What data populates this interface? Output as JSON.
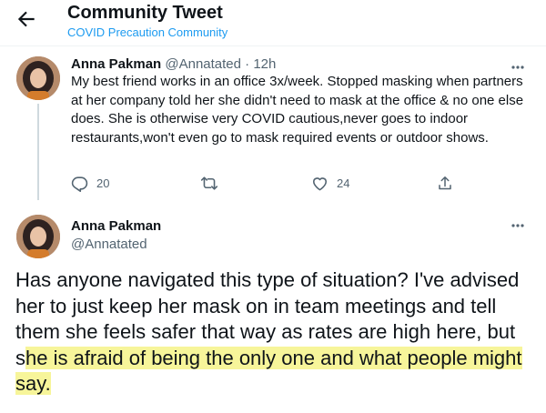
{
  "header": {
    "title": "Community Tweet",
    "subtitle": "COVID Precaution Community"
  },
  "tweet1": {
    "name": "Anna Pakman",
    "handle": "@Annatated",
    "separator": " · ",
    "time": "12h",
    "text": "My best friend works in an office 3x/week. Stopped masking when partners at her company told her she didn't need to mask at the office & no one else does. She is otherwise very COVID cautious,never goes to indoor restaurants,won't even go to mask required events or outdoor shows.",
    "replies": "20",
    "retweets": "",
    "likes": "24"
  },
  "tweet2": {
    "name": "Anna Pakman",
    "handle": "@Annatated",
    "text_plain": "Has anyone navigated this type of situation? I've advised her to just keep her mask on in team meetings and tell them she feels safer that way as rates are high here, but s",
    "text_highlight": "he is afraid of being the only one and what people might say."
  },
  "colors": {
    "accent": "#1d9bf0",
    "muted": "#536471",
    "highlight": "#f7f59a"
  },
  "icons": [
    "back-arrow-icon",
    "more-icon",
    "reply-icon",
    "retweet-icon",
    "like-icon",
    "share-icon"
  ]
}
